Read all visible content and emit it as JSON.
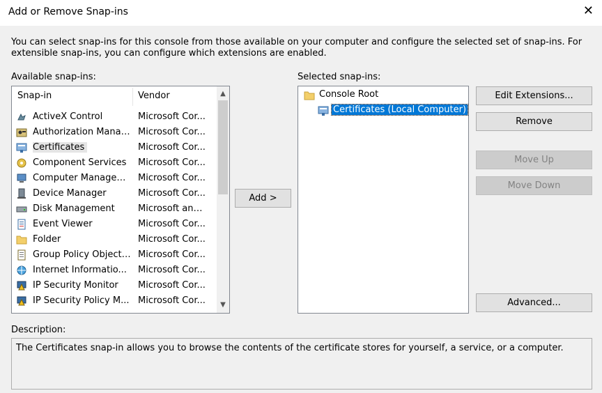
{
  "window": {
    "title": "Add or Remove Snap-ins",
    "close_glyph": "✕"
  },
  "intro_text": "You can select snap-ins for this console from those available on your computer and configure the selected set of snap-ins. For extensible snap-ins, you can configure which extensions are enabled.",
  "available": {
    "label": "Available snap-ins:",
    "columns": {
      "snapin": "Snap-in",
      "vendor": "Vendor"
    },
    "items": [
      {
        "name": "ActiveX Control",
        "vendor": "Microsoft Cor...",
        "icon": "activex-icon"
      },
      {
        "name": "Authorization Manager",
        "vendor": "Microsoft Cor...",
        "icon": "authorization-icon"
      },
      {
        "name": "Certificates",
        "vendor": "Microsoft Cor...",
        "icon": "certificates-icon",
        "selected": true
      },
      {
        "name": "Component Services",
        "vendor": "Microsoft Cor...",
        "icon": "component-services-icon"
      },
      {
        "name": "Computer Managem...",
        "vendor": "Microsoft Cor...",
        "icon": "computer-management-icon"
      },
      {
        "name": "Device Manager",
        "vendor": "Microsoft Cor...",
        "icon": "device-manager-icon"
      },
      {
        "name": "Disk Management",
        "vendor": "Microsoft and...",
        "icon": "disk-management-icon"
      },
      {
        "name": "Event Viewer",
        "vendor": "Microsoft Cor...",
        "icon": "event-viewer-icon"
      },
      {
        "name": "Folder",
        "vendor": "Microsoft Cor...",
        "icon": "folder-icon"
      },
      {
        "name": "Group Policy Object ...",
        "vendor": "Microsoft Cor...",
        "icon": "group-policy-icon"
      },
      {
        "name": "Internet Informatio...",
        "vendor": "Microsoft Cor...",
        "icon": "iis-icon"
      },
      {
        "name": "IP Security Monitor",
        "vendor": "Microsoft Cor...",
        "icon": "ip-security-icon"
      },
      {
        "name": "IP Security Policy M...",
        "vendor": "Microsoft Cor...",
        "icon": "ip-security-policy-icon"
      }
    ]
  },
  "add_button": "Add >",
  "selected": {
    "label": "Selected snap-ins:",
    "root": "Console Root",
    "child": "Certificates (Local Computer)"
  },
  "buttons": {
    "edit_extensions": "Edit Extensions...",
    "remove": "Remove",
    "move_up": "Move Up",
    "move_down": "Move Down",
    "advanced": "Advanced..."
  },
  "description": {
    "label": "Description:",
    "text": "The Certificates snap-in allows you to browse the contents of the certificate stores for yourself, a service, or a computer."
  },
  "colors": {
    "selection": "#0078d7",
    "window_bg": "#f0f0f0",
    "disabled_button": "#cccccc"
  }
}
